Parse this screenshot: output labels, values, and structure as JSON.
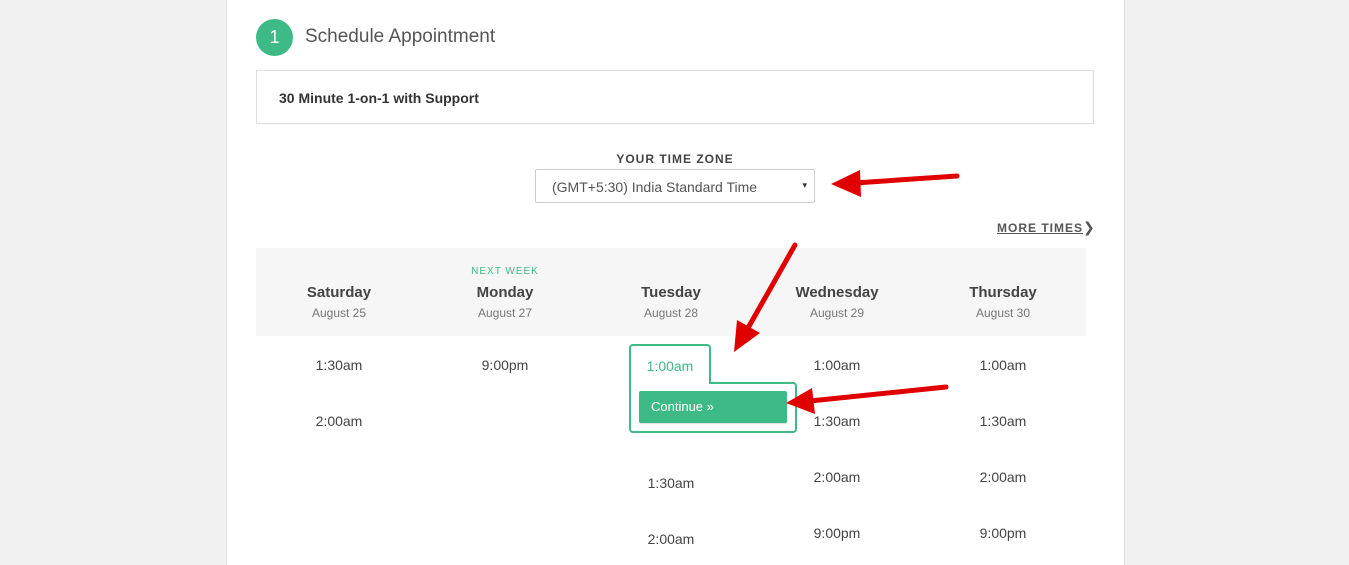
{
  "header": {
    "step_number": "1",
    "title": "Schedule Appointment"
  },
  "service": {
    "name": "30 Minute 1-on-1 with Support"
  },
  "timezone": {
    "label": "YOUR TIME ZONE",
    "value": "(GMT+5:30) India Standard Time",
    "caret": "▾"
  },
  "more_times": {
    "label": "MORE TIMES",
    "chevron": "❯"
  },
  "days": [
    {
      "tag": "",
      "name": "Saturday",
      "date": "August 25",
      "slots": [
        "1:30am",
        "2:00am"
      ]
    },
    {
      "tag": "NEXT WEEK",
      "name": "Monday",
      "date": "August 27",
      "slots": [
        "9:00pm"
      ]
    },
    {
      "tag": "",
      "name": "Tuesday",
      "date": "August 28",
      "slots": [
        "1:00am",
        "1:30am",
        "2:00am"
      ]
    },
    {
      "tag": "",
      "name": "Wednesday",
      "date": "August 29",
      "slots": [
        "1:00am",
        "1:30am",
        "2:00am",
        "9:00pm"
      ]
    },
    {
      "tag": "",
      "name": "Thursday",
      "date": "August 30",
      "slots": [
        "1:00am",
        "1:30am",
        "2:00am",
        "9:00pm"
      ]
    }
  ],
  "selected_slot": {
    "time": "1:00am",
    "continue_label": "Continue »"
  },
  "colors": {
    "accent": "#3dba85",
    "annotation_arrow": "#e00000"
  }
}
